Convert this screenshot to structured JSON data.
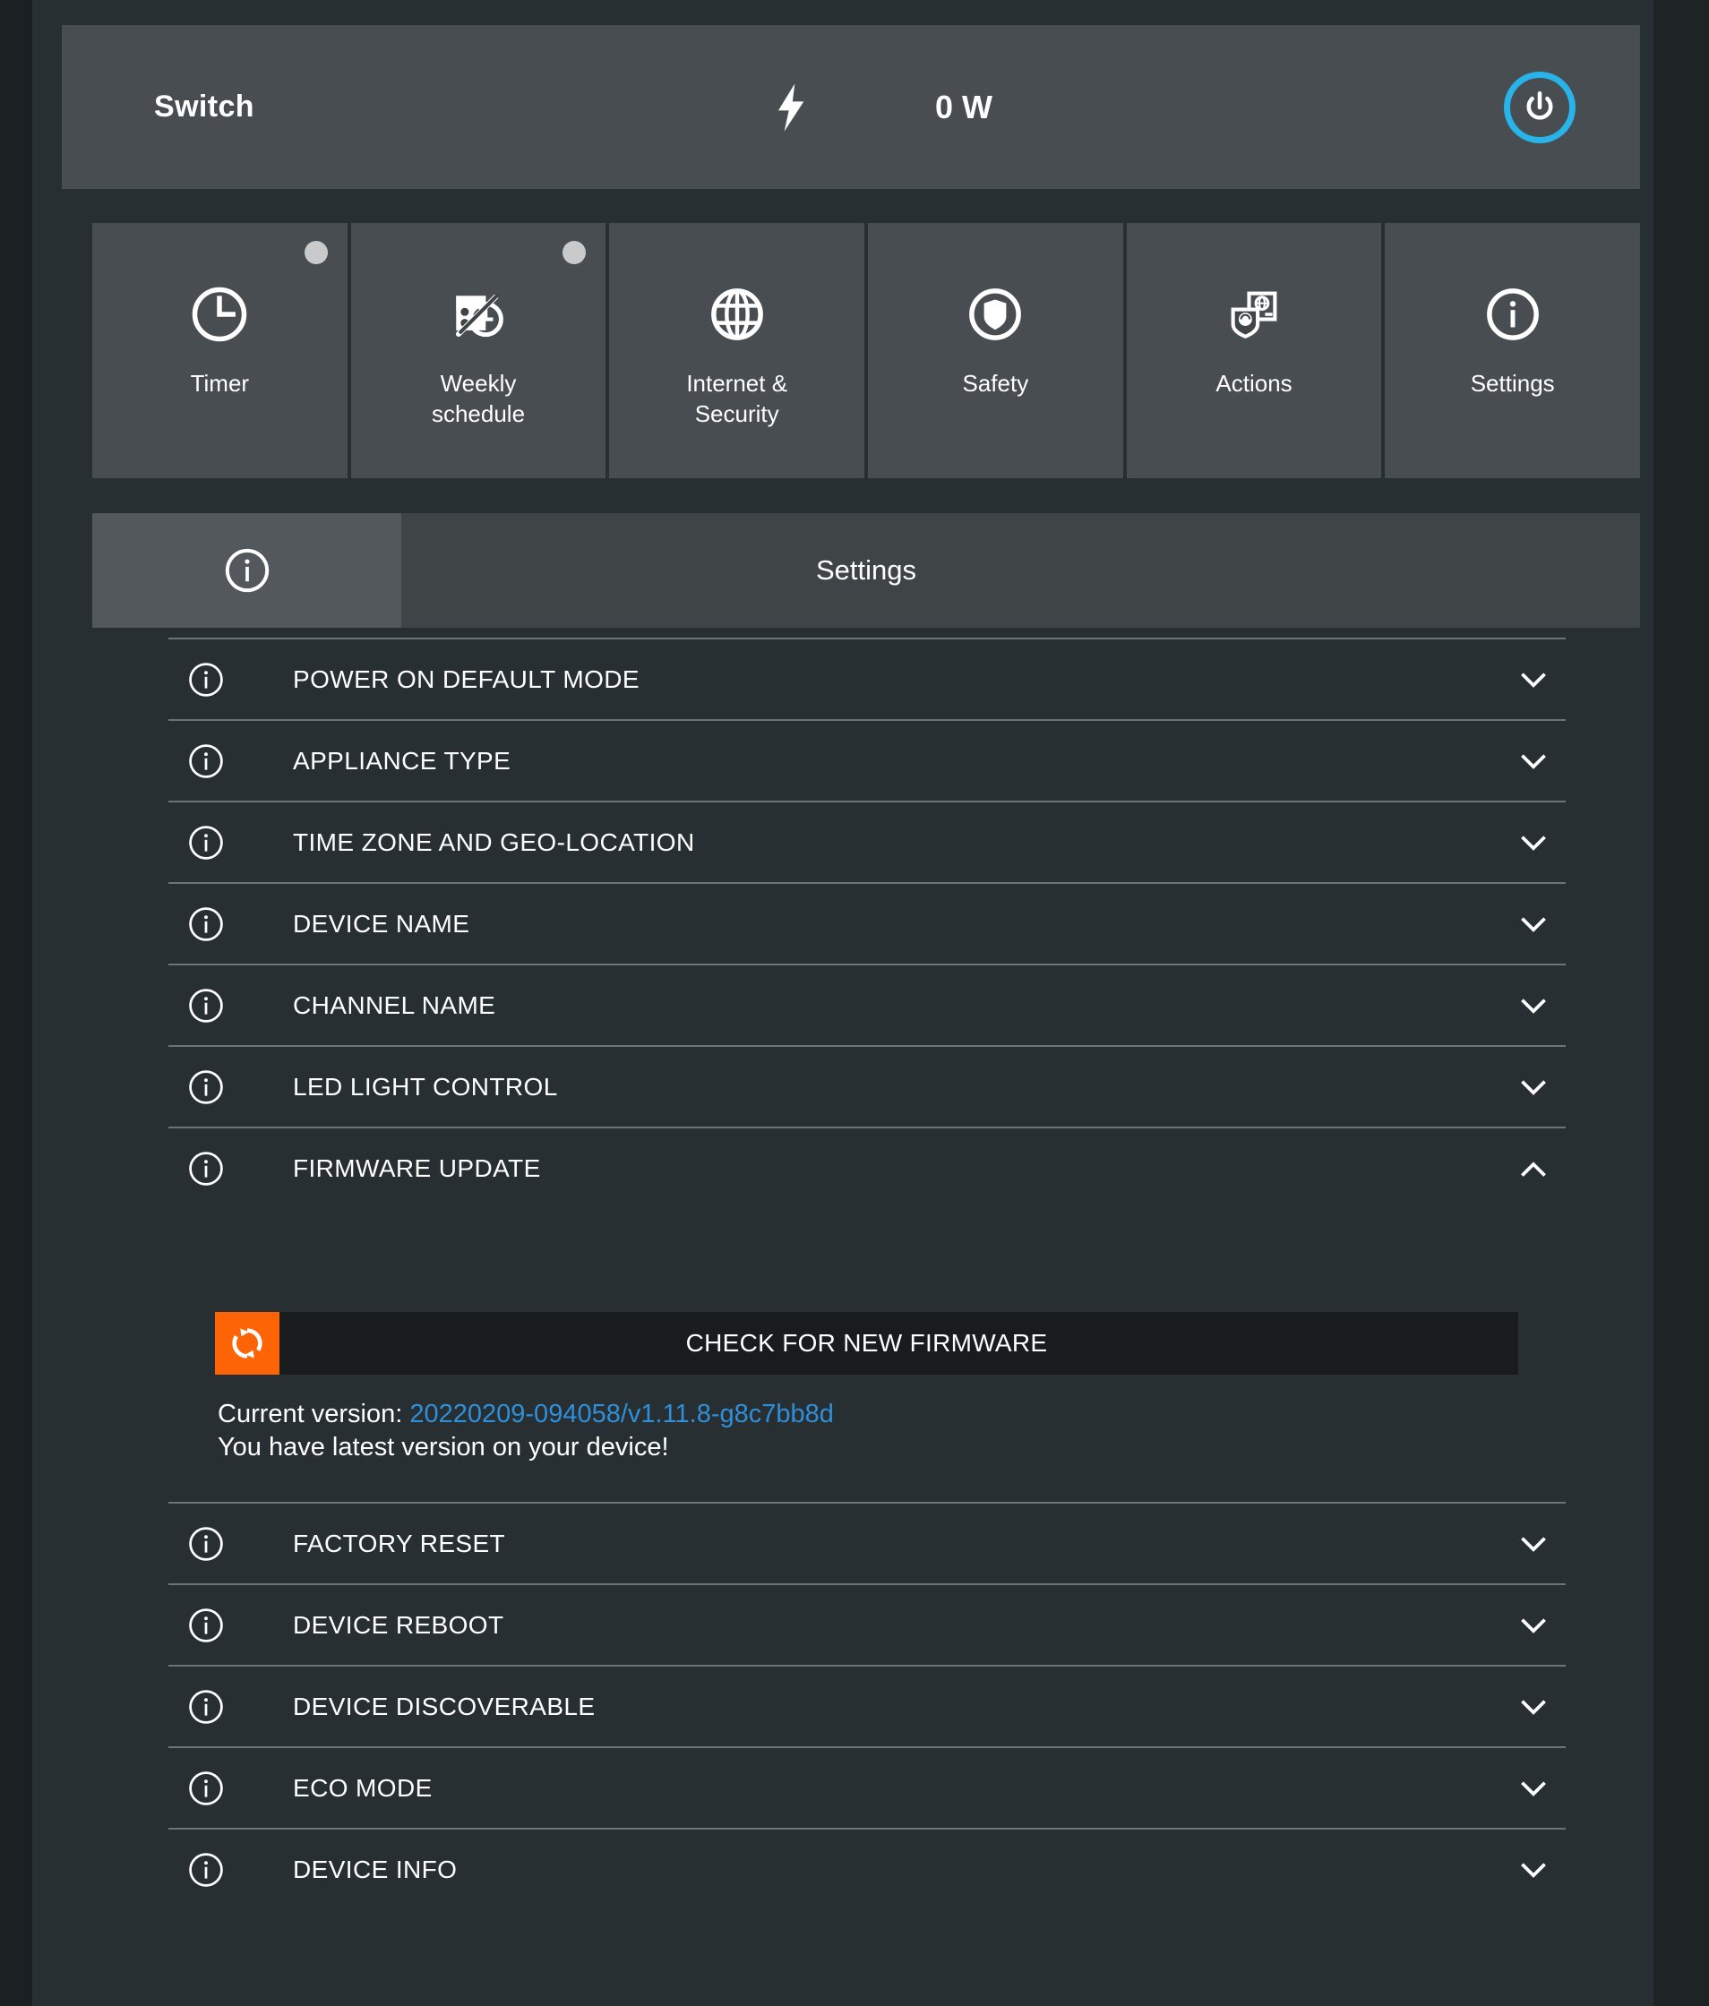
{
  "header": {
    "title": "Switch",
    "power_icon": "lightning-bolt-icon",
    "power_value": "0 W",
    "power_button_icon": "power-icon",
    "power_button_color": "#28b4e8"
  },
  "tabs": [
    {
      "label": "Timer",
      "icon": "clock-icon",
      "badge": true
    },
    {
      "label": "Weekly\nschedule",
      "icon": "schedule-disabled-icon",
      "badge": true
    },
    {
      "label": "Internet &\nSecurity",
      "icon": "globe-icon",
      "badge": false
    },
    {
      "label": "Safety",
      "icon": "shield-icon",
      "badge": false
    },
    {
      "label": "Actions",
      "icon": "actions-icon",
      "badge": false
    },
    {
      "label": "Settings",
      "icon": "info-icon",
      "badge": false
    }
  ],
  "settings_header": {
    "icon": "info-icon",
    "title": "Settings"
  },
  "settings_rows": [
    {
      "label": "POWER ON DEFAULT MODE",
      "icon": "info-icon",
      "expanded": false,
      "chevron": "chevron-down-icon"
    },
    {
      "label": "APPLIANCE TYPE",
      "icon": "info-icon",
      "expanded": false,
      "chevron": "chevron-down-icon"
    },
    {
      "label": "TIME ZONE AND GEO-LOCATION",
      "icon": "info-icon",
      "expanded": false,
      "chevron": "chevron-down-icon"
    },
    {
      "label": "DEVICE NAME",
      "icon": "info-icon",
      "expanded": false,
      "chevron": "chevron-down-icon"
    },
    {
      "label": "CHANNEL NAME",
      "icon": "info-icon",
      "expanded": false,
      "chevron": "chevron-down-icon"
    },
    {
      "label": "LED LIGHT CONTROL",
      "icon": "info-icon",
      "expanded": false,
      "chevron": "chevron-down-icon"
    },
    {
      "label": "FIRMWARE UPDATE",
      "icon": "info-icon",
      "expanded": true,
      "chevron": "chevron-up-icon"
    },
    {
      "label": "FACTORY RESET",
      "icon": "info-icon",
      "expanded": false,
      "chevron": "chevron-down-icon"
    },
    {
      "label": "DEVICE REBOOT",
      "icon": "info-icon",
      "expanded": false,
      "chevron": "chevron-down-icon"
    },
    {
      "label": "DEVICE DISCOVERABLE",
      "icon": "info-icon",
      "expanded": false,
      "chevron": "chevron-down-icon"
    },
    {
      "label": "ECO MODE",
      "icon": "info-icon",
      "expanded": false,
      "chevron": "chevron-down-icon"
    },
    {
      "label": "DEVICE INFO",
      "icon": "info-icon",
      "expanded": false,
      "chevron": "chevron-down-icon"
    }
  ],
  "firmware": {
    "check_button_label": "CHECK FOR NEW FIRMWARE",
    "check_button_icon": "refresh-icon",
    "check_button_accent": "#fc6405",
    "current_version_label": "Current version:",
    "current_version_value": "20220209-094058/v1.11.8-g8c7bb8d",
    "version_link_color": "#2f8fd8",
    "status_text": "You have latest version on your device!"
  },
  "colors": {
    "page_background": "#272f32",
    "card_background": "#484d51",
    "header_bar": "#3f4447",
    "header_icon_box": "#53585c",
    "divider": "#6d7376",
    "button_dark": "#181c1c",
    "badge": "#c9cacb"
  }
}
